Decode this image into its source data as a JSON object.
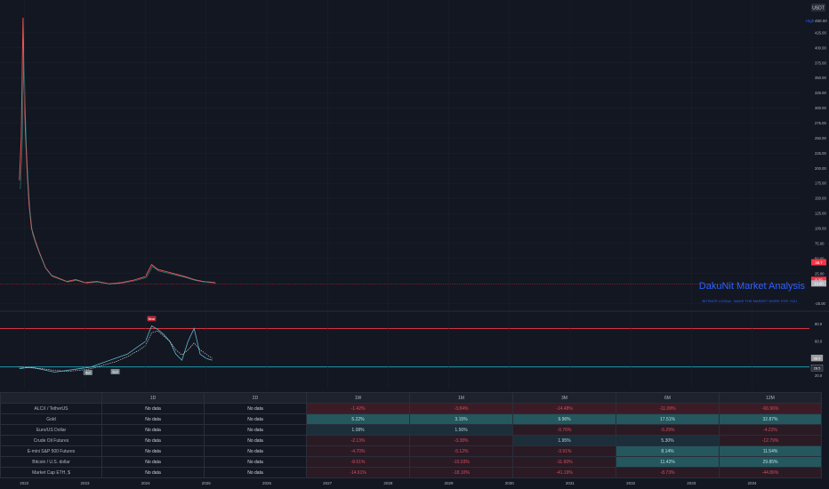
{
  "currency": "USDT",
  "high_label": "High",
  "high_value": "450.00",
  "watermark_title": "DakuNit Market Analysis",
  "watermark_subtitle": "BITSKER LOGNA - MAKE THE MARKET WORK FOR YOU",
  "chart_data": [
    {
      "type": "line",
      "name": "price",
      "y_axis_ticks": [
        425.0,
        400.0,
        375.0,
        350.0,
        325.0,
        300.0,
        275.0,
        250.0,
        225.0,
        200.0,
        175.0,
        150.0,
        125.0,
        100.0,
        75.0,
        50.0,
        25.0,
        -25.0
      ],
      "y_tick_labels": [
        "425.00",
        "400.00",
        "375.00",
        "350.00",
        "325.00",
        "300.00",
        "275.00",
        "250.00",
        "225.00",
        "200.00",
        "175.00",
        "150.00",
        "125.00",
        "100.00",
        "75.00",
        "50.00",
        "25.00",
        "-25.00"
      ],
      "ylim": [
        -30,
        450
      ],
      "x_axis_ticks": [
        "2022",
        "2023",
        "2024",
        "2025",
        "2026",
        "2027",
        "2028",
        "2029",
        "2030",
        "2031",
        "2032",
        "2033",
        "2034"
      ],
      "price_labels": [
        "38.7",
        "8.39",
        "10.80"
      ],
      "ema_labels": [],
      "x": [
        2021.92,
        2021.95,
        2021.98,
        2022.0,
        2022.02,
        2022.05,
        2022.08,
        2022.12,
        2022.18,
        2022.25,
        2022.35,
        2022.45,
        2022.55,
        2022.7,
        2022.85,
        2023.0,
        2023.2,
        2023.4,
        2023.6,
        2023.8,
        2024.0,
        2024.1,
        2024.2,
        2024.35,
        2024.5,
        2024.65,
        2024.8,
        2024.95,
        2025.05,
        2025.15
      ],
      "y": [
        180,
        250,
        450,
        330,
        260,
        190,
        140,
        100,
        80,
        60,
        35,
        22,
        18,
        12,
        15,
        10,
        12,
        8,
        10,
        14,
        20,
        40,
        32,
        28,
        24,
        20,
        15,
        12,
        11,
        10
      ]
    },
    {
      "type": "line",
      "name": "oscillator",
      "y_axis_ticks": [
        80.0,
        60.0,
        40.0,
        20.0
      ],
      "y_tick_labels": [
        "80.0",
        "60.0",
        "40.0",
        "20.0"
      ],
      "ylim": [
        10,
        90
      ],
      "upper_band": 75,
      "lower_band": 30,
      "badges": [
        "Bear",
        "Bull",
        "Bull"
      ],
      "value_labels": [
        "38.0",
        "28.5"
      ],
      "x": [
        2021.92,
        2022.1,
        2022.3,
        2022.5,
        2022.7,
        2022.9,
        2023.1,
        2023.3,
        2023.5,
        2023.7,
        2023.9,
        2024.0,
        2024.1,
        2024.2,
        2024.3,
        2024.4,
        2024.5,
        2024.6,
        2024.7,
        2024.8,
        2024.9,
        2025.0,
        2025.1
      ],
      "values": [
        28,
        30,
        27,
        24,
        26,
        28,
        30,
        35,
        40,
        45,
        55,
        60,
        78,
        74,
        68,
        60,
        45,
        38,
        60,
        75,
        45,
        40,
        38
      ],
      "signal": [
        30,
        29,
        28,
        26,
        25,
        26,
        28,
        32,
        36,
        42,
        50,
        55,
        70,
        72,
        66,
        60,
        50,
        44,
        50,
        58,
        50,
        45,
        40
      ]
    }
  ],
  "table": {
    "headers": [
      "",
      "1D",
      "2D",
      "1W",
      "1M",
      "3M",
      "6M",
      "12M"
    ],
    "rows": [
      {
        "symbol": "ALCX / TetherUS",
        "cells": [
          [
            "No data",
            "nd"
          ],
          [
            "No data",
            "nd"
          ],
          [
            "-1.42%",
            "neg"
          ],
          [
            "-3.84%",
            "neg"
          ],
          [
            "-14.48%",
            "neg"
          ],
          [
            "-11.09%",
            "neg"
          ],
          [
            "-66.96%",
            "neg"
          ]
        ]
      },
      {
        "symbol": "Gold",
        "cells": [
          [
            "No data",
            "nd"
          ],
          [
            "No data",
            "nd"
          ],
          [
            "5.22%",
            "pos"
          ],
          [
            "3.15%",
            "pos"
          ],
          [
            "9.96%",
            "pos"
          ],
          [
            "17.51%",
            "pos"
          ],
          [
            "32.87%",
            "pos"
          ]
        ]
      },
      {
        "symbol": "Euro/US Dollar",
        "cells": [
          [
            "No data",
            "nd"
          ],
          [
            "No data",
            "nd"
          ],
          [
            "1.08%",
            "posd"
          ],
          [
            "1.56%",
            "posd"
          ],
          [
            "-0.76%",
            "negd"
          ],
          [
            "-5.29%",
            "negd"
          ],
          [
            "-4.22%",
            "negd"
          ]
        ]
      },
      {
        "symbol": "Crude Oil Futures",
        "cells": [
          [
            "No data",
            "nd"
          ],
          [
            "No data",
            "nd"
          ],
          [
            "-2.13%",
            "negd"
          ],
          [
            "-3.38%",
            "negd"
          ],
          [
            "1.95%",
            "posd"
          ],
          [
            "5.30%",
            "posd"
          ],
          [
            "-12.79%",
            "negd"
          ]
        ]
      },
      {
        "symbol": "E-mini S&P 500 Futures",
        "cells": [
          [
            "No data",
            "nd"
          ],
          [
            "No data",
            "nd"
          ],
          [
            "-4.70%",
            "negd"
          ],
          [
            "-5.12%",
            "negd"
          ],
          [
            "-3.91%",
            "negd"
          ],
          [
            "8.14%",
            "pos"
          ],
          [
            "11.54%",
            "pos"
          ]
        ]
      },
      {
        "symbol": "Bitcoin / U.S. dollar",
        "cells": [
          [
            "No data",
            "nd"
          ],
          [
            "No data",
            "nd"
          ],
          [
            "-8.61%",
            "negd"
          ],
          [
            "-10.03%",
            "negd"
          ],
          [
            "-11.60%",
            "negd"
          ],
          [
            "11.42%",
            "pos"
          ],
          [
            "29.85%",
            "pos"
          ]
        ]
      },
      {
        "symbol": "Market Cap ETH, $",
        "cells": [
          [
            "No data",
            "nd"
          ],
          [
            "No data",
            "nd"
          ],
          [
            "-14.61%",
            "negd"
          ],
          [
            "-18.10%",
            "negd"
          ],
          [
            "-41.19%",
            "negd"
          ],
          [
            "-8.73%",
            "negd"
          ],
          [
            "-44.86%",
            "negd"
          ]
        ]
      }
    ]
  },
  "colors": {
    "background": "#131722",
    "price_up": "#26a69a",
    "price_down": "#ef5350",
    "grid": "#1e222d",
    "upper_band": "#f23645",
    "lower_band": "#2196f3",
    "watermark": "#2962ff"
  }
}
